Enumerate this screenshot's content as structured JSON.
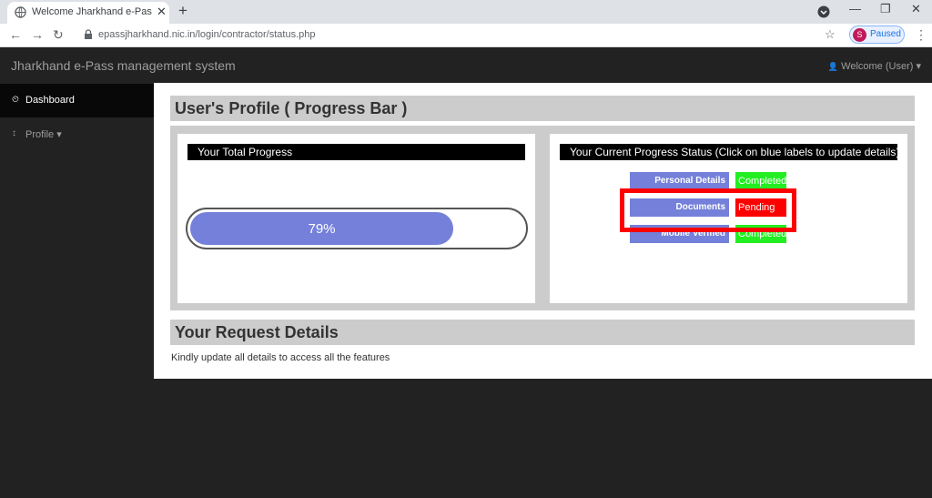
{
  "browser": {
    "tab_title": "Welcome Jharkhand e-Pass management system",
    "new_tab": "+",
    "close_tab": "✕",
    "url": "epassjharkhand.nic.in/login/contractor/status.php",
    "profile_initial": "S",
    "profile_status": "Paused",
    "nav_back": "←",
    "nav_forward": "→",
    "nav_reload": "↻",
    "star": "☆",
    "menu": "⋮",
    "window_minimize": "—",
    "window_restore": "❐",
    "window_close": "✕",
    "icons": [
      "back-arrow-icon",
      "forward-arrow-icon",
      "reload-icon",
      "lock-icon",
      "star-icon",
      "kebab-menu-icon"
    ]
  },
  "navbar": {
    "brand": "Jharkhand e-Pass management system",
    "welcome": "Welcome (User)",
    "welcome_icon": "👤",
    "caret": "▾"
  },
  "sidebar": {
    "items": [
      {
        "label": "Dashboard",
        "icon": "dashboard-icon",
        "glyph": "⏲",
        "active": true
      },
      {
        "label": "Profile",
        "icon": "user-icon",
        "glyph": "↕",
        "active": false,
        "caret": "▾"
      }
    ]
  },
  "main": {
    "profile_heading": "User's Profile ( Progress Bar )",
    "total_progress_title": "Your Total Progress",
    "progress_percent": 79,
    "progress_text": "79%",
    "status_title": "Your Current Progress Status (Click on blue labels to update details)",
    "status_items": [
      {
        "label": "Personal Details",
        "status": "Completed",
        "color": "#22ee22"
      },
      {
        "label": "Documents",
        "status": "Pending",
        "color": "#ff0000"
      },
      {
        "label": "Mobile Verified",
        "status": "Completed",
        "color": "#22ee22"
      }
    ],
    "request_heading": "Your Request Details",
    "request_note": "Kindly update all details to access all the features"
  },
  "colors": {
    "accent": "#7480d9",
    "navbar": "#222222",
    "heading_bg": "#cccccc",
    "highlight": "#ff0000"
  }
}
